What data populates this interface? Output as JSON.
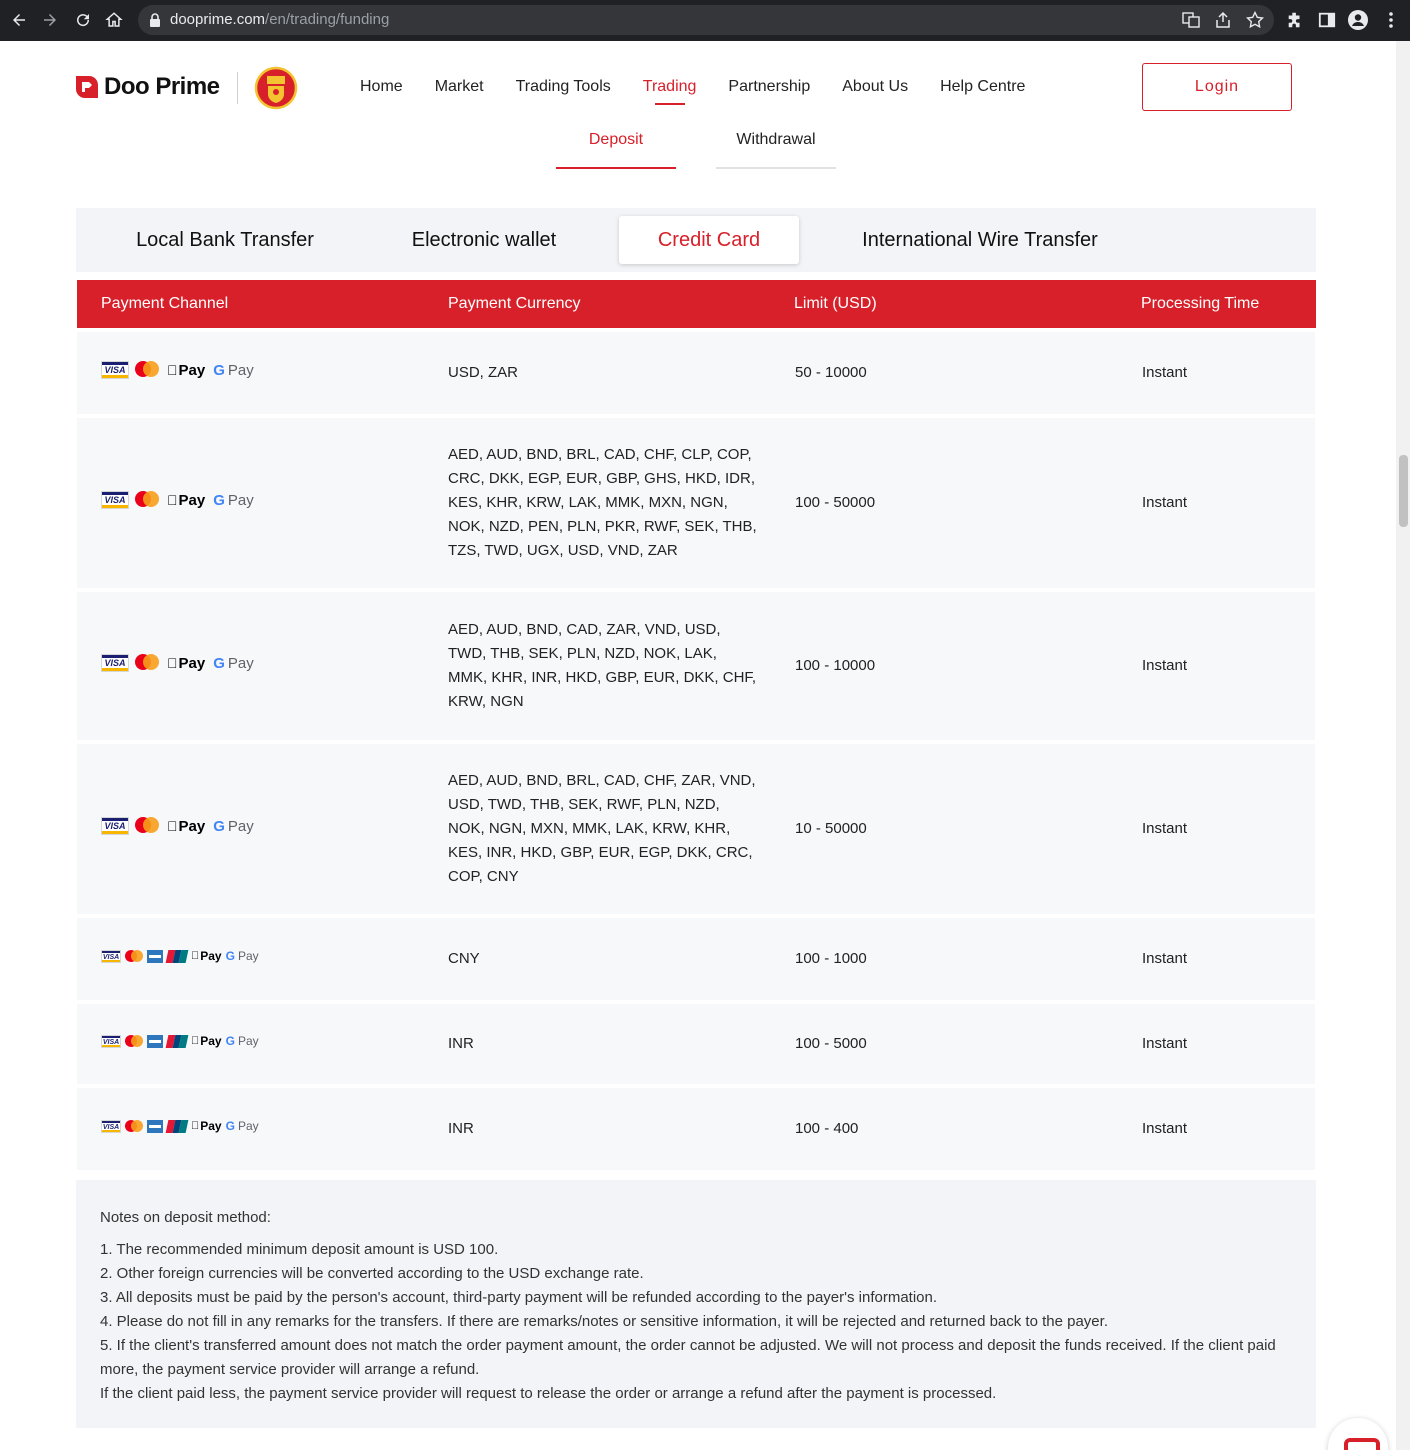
{
  "browser": {
    "url_domain": "dooprime.com",
    "url_path": "/en/trading/funding"
  },
  "header": {
    "brand": "Doo Prime",
    "nav": [
      "Home",
      "Market",
      "Trading Tools",
      "Trading",
      "Partnership",
      "About Us",
      "Help Centre"
    ],
    "active_nav": "Trading",
    "login_label": "Login"
  },
  "sub_nav": {
    "deposit": "Deposit",
    "withdrawal": "Withdrawal",
    "active": "Deposit"
  },
  "method_tabs": {
    "items": [
      "Local Bank Transfer",
      "Electronic wallet",
      "Credit Card",
      "International Wire Transfer"
    ],
    "active": "Credit Card"
  },
  "table": {
    "headers": [
      "Payment Channel",
      "Payment Currency",
      "Limit (USD)",
      "Processing Time"
    ],
    "rows": [
      {
        "channels": [
          "visa-icon",
          "mastercard-icon",
          "apple-pay-icon",
          "google-pay-icon"
        ],
        "currency": "USD, ZAR",
        "limit": "50 - 10000",
        "time": "Instant"
      },
      {
        "channels": [
          "visa-icon",
          "mastercard-icon",
          "apple-pay-icon",
          "google-pay-icon"
        ],
        "currency": "AED, AUD, BND, BRL, CAD, CHF, CLP, COP, CRC, DKK, EGP, EUR, GBP, GHS, HKD, IDR, KES, KHR, KRW, LAK, MMK, MXN, NGN, NOK, NZD, PEN, PLN, PKR, RWF, SEK, THB, TZS, TWD, UGX, USD, VND, ZAR",
        "limit": "100 - 50000",
        "time": "Instant"
      },
      {
        "channels": [
          "visa-icon",
          "mastercard-icon",
          "apple-pay-icon",
          "google-pay-icon"
        ],
        "currency": "AED, AUD, BND, CAD, ZAR, VND, USD, TWD, THB, SEK, PLN, NZD, NOK, LAK, MMK, KHR, INR, HKD, GBP, EUR, DKK, CHF, KRW, NGN",
        "limit": "100 - 10000",
        "time": "Instant"
      },
      {
        "channels": [
          "visa-icon",
          "mastercard-icon",
          "apple-pay-icon",
          "google-pay-icon"
        ],
        "currency": "AED, AUD, BND, BRL, CAD, CHF, ZAR, VND, USD, TWD, THB, SEK, RWF, PLN, NZD, NOK, NGN, MXN, MMK, LAK, KRW, KHR, KES, INR, HKD, GBP, EUR, EGP, DKK, CRC, COP, CNY",
        "limit": "10 - 50000",
        "time": "Instant"
      },
      {
        "channels": [
          "visa-icon",
          "mastercard-icon",
          "amex-icon",
          "unionpay-icon",
          "apple-pay-icon",
          "google-pay-icon"
        ],
        "currency": "CNY",
        "limit": "100 - 1000",
        "time": "Instant"
      },
      {
        "channels": [
          "visa-icon",
          "mastercard-icon",
          "amex-icon",
          "unionpay-icon",
          "apple-pay-icon",
          "google-pay-icon"
        ],
        "currency": "INR",
        "limit": "100 - 5000",
        "time": "Instant"
      },
      {
        "channels": [
          "visa-icon",
          "mastercard-icon",
          "amex-icon",
          "unionpay-icon",
          "apple-pay-icon",
          "google-pay-icon"
        ],
        "currency": "INR",
        "limit": "100 - 400",
        "time": "Instant"
      }
    ]
  },
  "icon_labels": {
    "visa": "VISA",
    "apple_pay": "Pay",
    "google_g": "G",
    "google_pay": "Pay"
  },
  "notes": {
    "title": "Notes on deposit method:",
    "lines": [
      "1. The recommended minimum deposit amount is USD 100.",
      "2. Other foreign currencies will be converted according to the USD exchange rate.",
      "3. All deposits must be paid by the person's account, third-party payment will be refunded according to the payer's information.",
      "4. Please do not fill in any remarks for the transfers. If there are remarks/notes or sensitive information, it will be rejected and returned back to the payer.",
      "5. If the client's transferred amount does not match the order payment amount, the order cannot be adjusted. We will not process and deposit the funds received. If the client paid more, the payment service provider will arrange a refund.",
      "If the client paid less, the payment service provider will request to release the order or arrange a refund after the payment is processed."
    ]
  },
  "colors": {
    "accent": "#d8202a",
    "table_row_bg": "#f7f8fa",
    "tab_bar_bg": "#f2f4f7"
  }
}
